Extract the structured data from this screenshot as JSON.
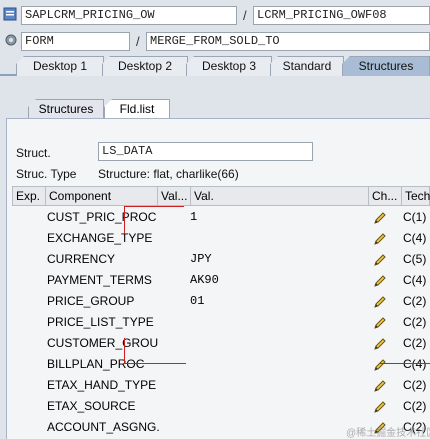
{
  "header": {
    "program": "SAPLCRM_PRICING_OW",
    "include": "LCRM_PRICING_OWF08",
    "event_type": "FORM",
    "event_name": "MERGE_FROM_SOLD_TO",
    "separator": "/"
  },
  "desktop_tabs": [
    {
      "label": "Desktop 1",
      "active": false
    },
    {
      "label": "Desktop 2",
      "active": false
    },
    {
      "label": "Desktop 3",
      "active": false
    },
    {
      "label": "Standard",
      "active": false
    },
    {
      "label": "Structures",
      "active": true
    }
  ],
  "sub_tabs": [
    {
      "label": "Structures",
      "active": false
    },
    {
      "label": "Fld.list",
      "active": true
    }
  ],
  "struct": {
    "label": "Struct.",
    "value": "LS_DATA",
    "type_label": "Struc. Type",
    "type_value": "Structure: flat, charlike(66)"
  },
  "table": {
    "headers": [
      "Exp.",
      "Component",
      "Val...",
      "Val.",
      "Ch...",
      "Tech"
    ],
    "rows": [
      {
        "component": "CUST_PRIC_PROC",
        "value": "1",
        "tech": "C(1)"
      },
      {
        "component": "EXCHANGE_TYPE",
        "value": "",
        "tech": "C(4)"
      },
      {
        "component": "CURRENCY",
        "value": "JPY",
        "tech": "C(5)"
      },
      {
        "component": "PAYMENT_TERMS",
        "value": "AK90",
        "tech": "C(4)"
      },
      {
        "component": "PRICE_GROUP",
        "value": "01",
        "tech": "C(2)"
      },
      {
        "component": "PRICE_LIST_TYPE",
        "value": "",
        "tech": "C(2)"
      },
      {
        "component": "CUSTOMER_GROUP",
        "value": "",
        "tech": "C(2)"
      },
      {
        "component": "BILLPLAN_PROC",
        "value": "",
        "tech": "C(4)"
      },
      {
        "component": "ETAX_HAND_TYPE",
        "value": "",
        "tech": "C(2)"
      },
      {
        "component": "ETAX_SOURCE",
        "value": "",
        "tech": "C(2)"
      },
      {
        "component": "ACCOUNT_ASGNG...",
        "value": "",
        "tech": "C(2)"
      }
    ]
  },
  "watermark": "@稀土掘金技术社区",
  "colors": {
    "accent_tab": "#a9bcd5",
    "annotation": "#cc1f1f"
  }
}
